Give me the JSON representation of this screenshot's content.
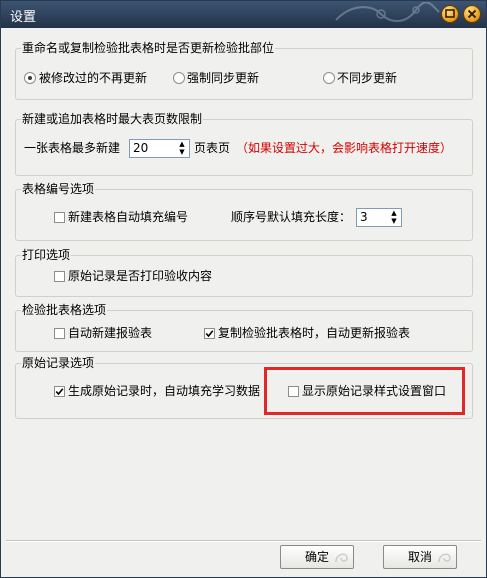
{
  "window": {
    "title": "设置"
  },
  "group_rename": {
    "legend": "重命名或复制检验批表格时是否更新检验批部位",
    "options": [
      "被修改过的不再更新",
      "强制同步更新",
      "不同步更新"
    ],
    "selected_index": 0
  },
  "group_maxpages": {
    "legend": "新建或追加表格时最大表页数限制",
    "prefix": "一张表格最多新建",
    "value": "20",
    "suffix": "页表页",
    "hint": "（如果设置过大，会影响表格打开速度）"
  },
  "group_numbering": {
    "legend": "表格编号选项",
    "auto_fill_label": "新建表格自动填充编号",
    "auto_fill_checked": false,
    "seq_length_label": "顺序号默认填充长度：",
    "seq_length_value": "3"
  },
  "group_print": {
    "legend": "打印选项",
    "print_label": "原始记录是否打印验收内容",
    "print_checked": false
  },
  "group_batch": {
    "legend": "检验批表格选项",
    "auto_report_label": "自动新建报验表",
    "auto_report_checked": false,
    "copy_update_label": "复制检验批表格时，自动更新报验表",
    "copy_update_checked": true
  },
  "group_raw": {
    "legend": "原始记录选项",
    "learn_fill_label": "生成原始记录时，自动填充学习数据",
    "learn_fill_checked": true,
    "show_style_label": "显示原始记录样式设置窗口",
    "show_style_checked": false
  },
  "buttons": {
    "ok": "确定",
    "cancel": "取消"
  },
  "colors": {
    "hint": "#d40000",
    "highlight": "#e02828",
    "titlebar": "#2f4560"
  },
  "icons": {
    "minimize": "minimize-icon",
    "close": "close-icon",
    "check": "checkmark-icon"
  }
}
